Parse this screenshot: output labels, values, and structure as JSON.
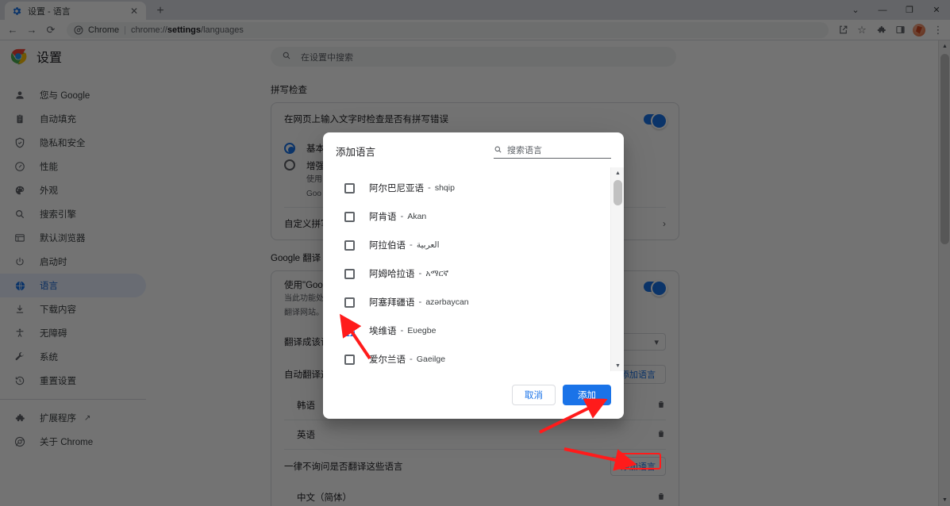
{
  "browser": {
    "tab": {
      "title": "设置 - 语言",
      "favicon": "gear-icon",
      "close": "✕"
    },
    "new_tab": "+",
    "window_controls": {
      "tab_search": "⌄",
      "minimize": "—",
      "maximize": "❐",
      "close": "✕"
    },
    "nav": {
      "back": "←",
      "forward": "→",
      "reload": "⟳"
    },
    "omnibox": {
      "scheme_label": "Chrome",
      "separator": "|",
      "url_prefix": "chrome://",
      "url_bold": "settings",
      "url_suffix": "/languages"
    },
    "toolbar_right": {
      "share": "⇪",
      "bookmark": "☆",
      "extensions": "puzzle-icon",
      "side_panel": "sidepanel-icon",
      "profile": "avatar",
      "menu": "⋮"
    }
  },
  "settings": {
    "title": "设置",
    "search_placeholder": "在设置中搜索",
    "search_icon": "search-icon",
    "sidebar": [
      {
        "label": "您与 Google",
        "icon": "person-icon",
        "active": false
      },
      {
        "label": "自动填充",
        "icon": "clipboard-icon",
        "active": false
      },
      {
        "label": "隐私和安全",
        "icon": "shield-icon",
        "active": false
      },
      {
        "label": "性能",
        "icon": "speedometer-icon",
        "active": false
      },
      {
        "label": "外观",
        "icon": "palette-icon",
        "active": false
      },
      {
        "label": "搜索引擎",
        "icon": "search-icon",
        "active": false
      },
      {
        "label": "默认浏览器",
        "icon": "browser-window-icon",
        "active": false
      },
      {
        "label": "启动时",
        "icon": "power-icon",
        "active": false
      },
      {
        "label": "语言",
        "icon": "globe-icon",
        "active": true
      },
      {
        "label": "下载内容",
        "icon": "download-icon",
        "active": false
      },
      {
        "label": "无障碍",
        "icon": "accessibility-icon",
        "active": false
      },
      {
        "label": "系统",
        "icon": "wrench-icon",
        "active": false
      },
      {
        "label": "重置设置",
        "icon": "history-restore-icon",
        "active": false
      }
    ],
    "sidebar_bottom": [
      {
        "label": "扩展程序",
        "icon": "puzzle-icon",
        "external": "↗"
      },
      {
        "label": "关于 Chrome",
        "icon": "chrome-icon",
        "external": ""
      }
    ]
  },
  "page": {
    "spellcheck": {
      "section_title": "拼写检查",
      "toggle_label": "在网页上输入文字时检查是否有拼写错误",
      "toggle_on": true,
      "option_basic": "基本",
      "option_enhanced": "增强",
      "option_enhanced_sub1": "使用",
      "option_enhanced_sub2": "Goo",
      "custom_spellcheck": "自定义拼写",
      "chevron": "›"
    },
    "translate": {
      "section_title": "Google 翻译",
      "use_translate_label": "使用\"Googl",
      "use_translate_sub1": "当此功能处",
      "use_translate_sub2": "翻译网站。",
      "use_translate_on": true,
      "target_label": "翻译成该语",
      "target_value": "",
      "auto_translate_label": "自动翻译这",
      "auto_translate_rows": [
        "韩语",
        "英语"
      ],
      "add_language_button_1": "添加语言",
      "never_translate_label": "一律不询问是否翻译这些语言",
      "never_translate_rows": [
        "中文（简体）"
      ],
      "add_language_button_2": "添加语言",
      "trash_icon": "trash-icon",
      "dropdown_arrow": "▾"
    }
  },
  "dialog": {
    "title": "添加语言",
    "search_icon": "search-icon",
    "search_placeholder": "搜索语言",
    "languages": [
      {
        "name": "阿尔巴尼亚语",
        "native": "shqip",
        "checked": false
      },
      {
        "name": "阿肯语",
        "native": "Akan",
        "checked": false
      },
      {
        "name": "阿拉伯语",
        "native": "العربية",
        "checked": false
      },
      {
        "name": "阿姆哈拉语",
        "native": "አማርኛ",
        "checked": false
      },
      {
        "name": "阿塞拜疆语",
        "native": "azərbaycan",
        "checked": false
      },
      {
        "name": "埃维语",
        "native": "Eʋegbe",
        "checked": true
      },
      {
        "name": "爱尔兰语",
        "native": "Gaeilge",
        "checked": false
      }
    ],
    "separator": "-",
    "cancel_label": "取消",
    "add_label": "添加",
    "scroll_up": "▲",
    "scroll_down": "▼"
  },
  "annotations": {
    "arrow_color": "#ff1b1b",
    "highlight_color": "#ff1b1b",
    "arrows": [
      {
        "name": "arrow-to-checkbox"
      },
      {
        "name": "arrow-to-add-button"
      },
      {
        "name": "arrow-to-add-language-button"
      }
    ]
  }
}
